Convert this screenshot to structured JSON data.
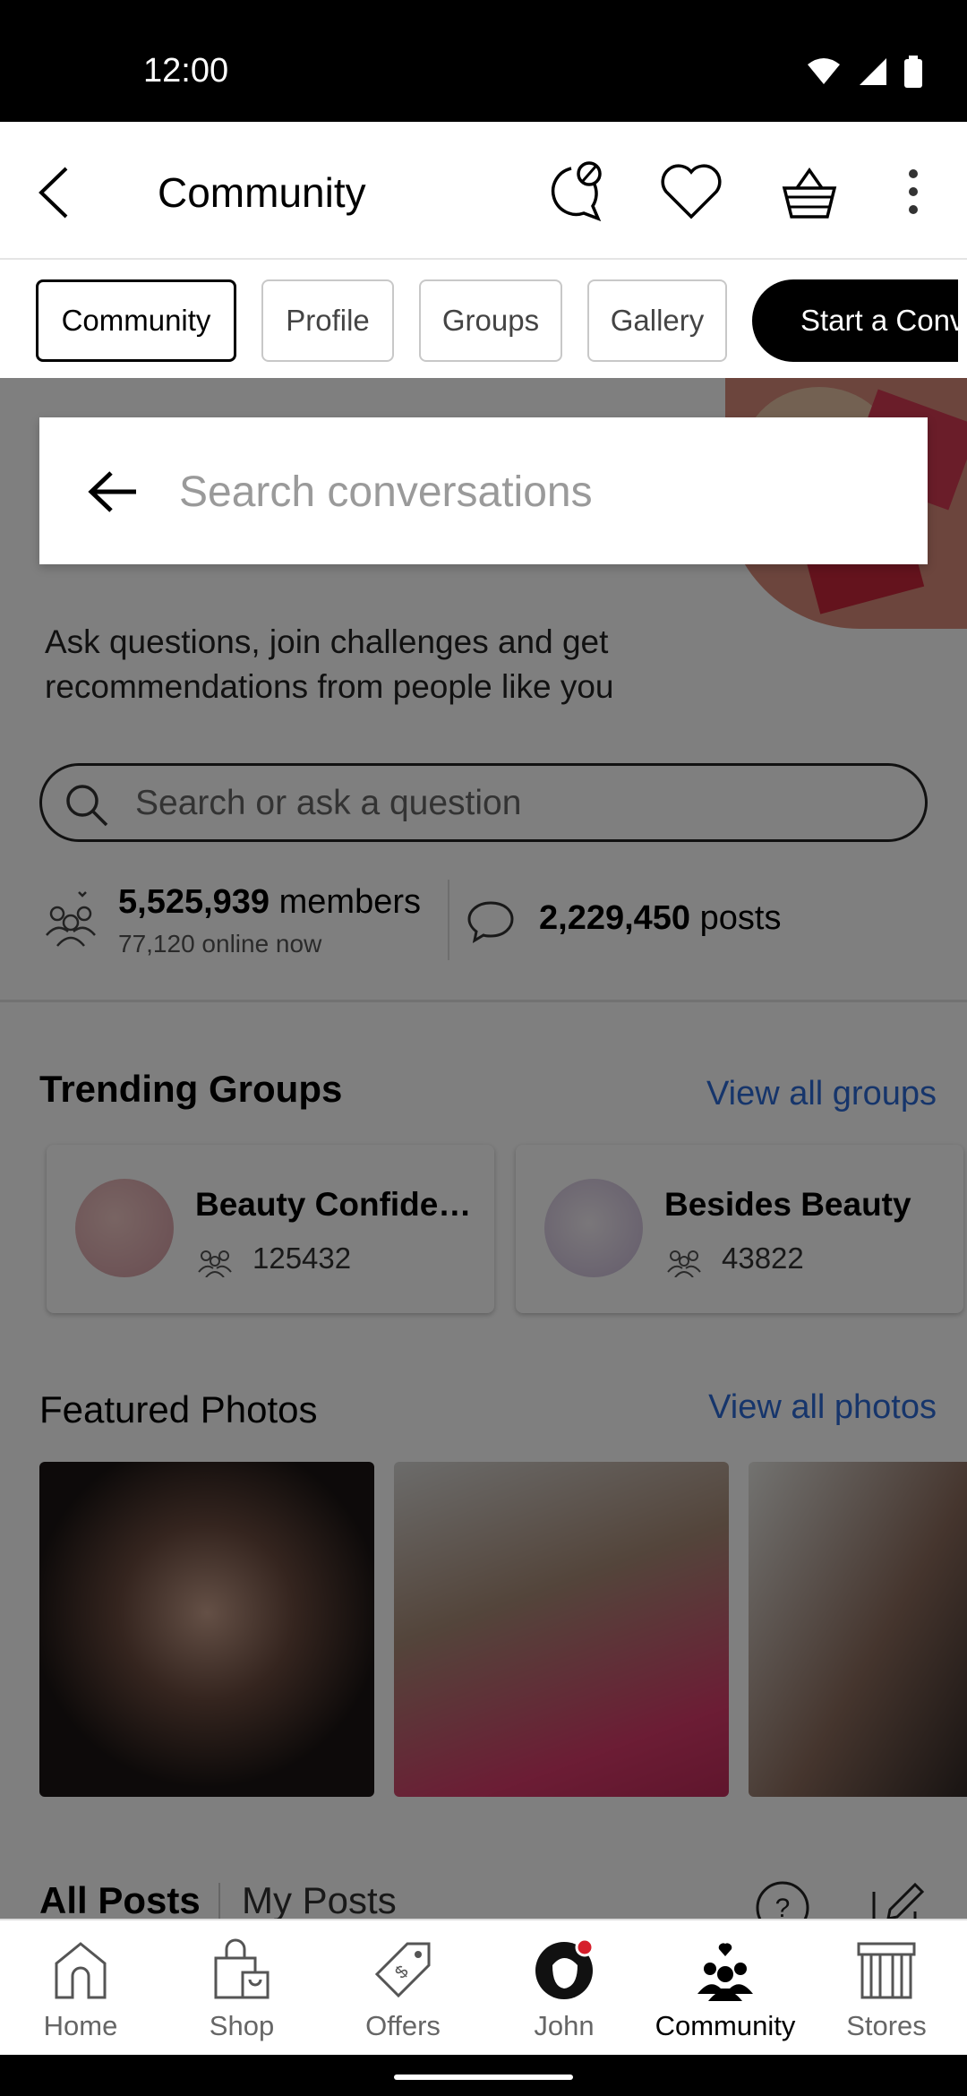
{
  "status_bar": {
    "time": "12:00"
  },
  "app_bar": {
    "title": "Community"
  },
  "chips": [
    {
      "label": "Community",
      "active": true
    },
    {
      "label": "Profile",
      "active": false
    },
    {
      "label": "Groups",
      "active": false
    },
    {
      "label": "Gallery",
      "active": false
    },
    {
      "label": "Start a Conv",
      "active": false
    }
  ],
  "search_overlay": {
    "placeholder": "Search conversations"
  },
  "intro_text": "Ask questions, join challenges and get recommendations from people like you",
  "question_search": {
    "placeholder": "Search or ask a question"
  },
  "stats": {
    "members_count": "5,525,939",
    "members_label": "members",
    "online_text": "77,120 online now",
    "posts_count": "2,229,450",
    "posts_label": "posts"
  },
  "trending": {
    "title": "Trending Groups",
    "view_all": "View all groups",
    "groups": [
      {
        "name": "Beauty Confide…",
        "members": "125432"
      },
      {
        "name": "Besides Beauty",
        "members": "43822"
      }
    ]
  },
  "featured": {
    "title": "Featured Photos",
    "view_all": "View all photos"
  },
  "posts_tabs": {
    "all": "All Posts",
    "mine": "My Posts"
  },
  "bottom_nav": [
    {
      "label": "Home",
      "icon": "home-icon"
    },
    {
      "label": "Shop",
      "icon": "shopping-bag-icon"
    },
    {
      "label": "Offers",
      "icon": "tag-icon"
    },
    {
      "label": "John",
      "icon": "profile-avatar-icon"
    },
    {
      "label": "Community",
      "icon": "community-icon",
      "active": true
    },
    {
      "label": "Stores",
      "icon": "store-icon"
    }
  ],
  "colors": {
    "link": "#2d6bd6",
    "notification_dot": "#d61f2c",
    "scrim": "rgba(0,0,0,0.5)"
  }
}
